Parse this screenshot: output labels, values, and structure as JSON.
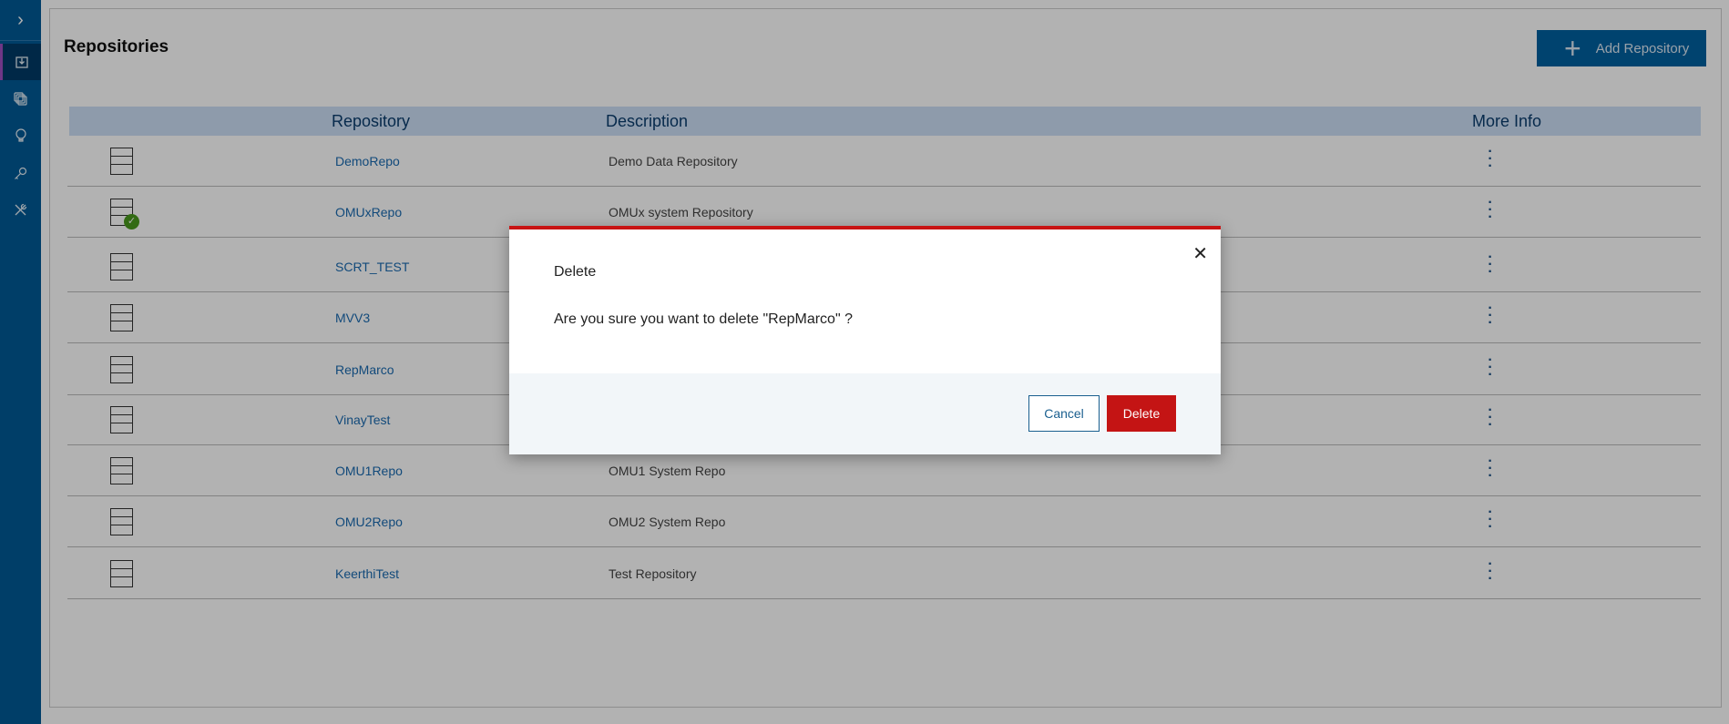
{
  "sidebar": {
    "items": [
      {
        "icon": "import-icon",
        "active": true
      },
      {
        "icon": "copy-icon"
      },
      {
        "icon": "lightbulb-icon"
      },
      {
        "icon": "key-icon"
      },
      {
        "icon": "tools-icon"
      }
    ]
  },
  "page": {
    "title": "Repositories",
    "add_button": "Add Repository"
  },
  "table": {
    "headers": {
      "repository": "Repository",
      "description": "Description",
      "more_info": "More Info"
    },
    "rows": [
      {
        "name": "DemoRepo",
        "description": "Demo Data Repository",
        "active": false
      },
      {
        "name": "OMUxRepo",
        "description": "OMUx system Repository",
        "active": true
      },
      {
        "name": "SCRT_TEST",
        "description": "",
        "active": false
      },
      {
        "name": "MVV3",
        "description": "",
        "active": false
      },
      {
        "name": "RepMarco",
        "description": "",
        "active": false
      },
      {
        "name": "VinayTest",
        "description": "",
        "active": false
      },
      {
        "name": "OMU1Repo",
        "description": "OMU1 System Repo",
        "active": false
      },
      {
        "name": "OMU2Repo",
        "description": "OMU2 System Repo",
        "active": false
      },
      {
        "name": "KeerthiTest",
        "description": "Test Repository",
        "active": false
      }
    ]
  },
  "dialog": {
    "title": "Delete",
    "message": "Are you sure you want to delete \"RepMarco\" ?",
    "cancel": "Cancel",
    "confirm": "Delete",
    "accent": "#c81414"
  }
}
